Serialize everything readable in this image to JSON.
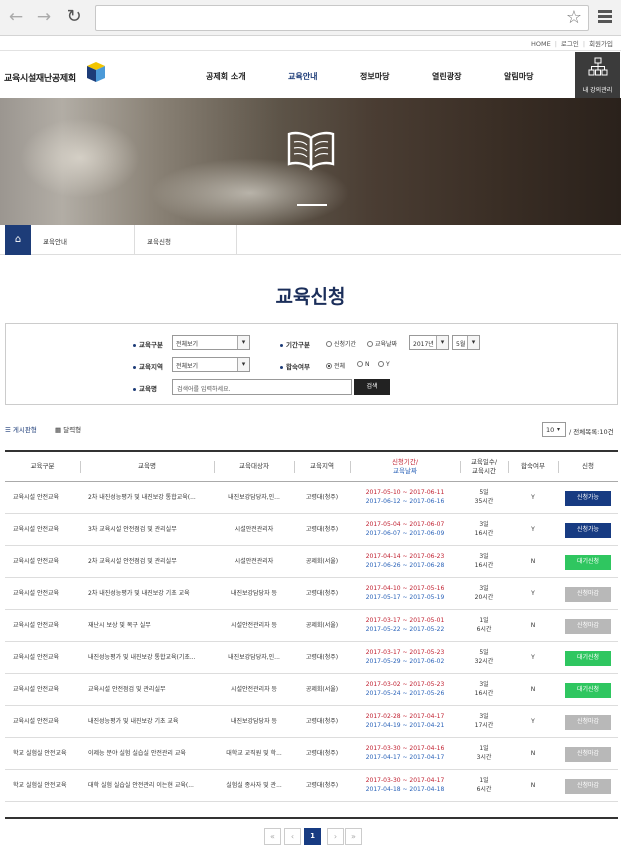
{
  "browser": {
    "url": ""
  },
  "util_links": [
    "HOME",
    "로그인",
    "회원가입"
  ],
  "site": {
    "name": "교육시설재난공제회"
  },
  "gnb": [
    "공제회 소개",
    "교육안내",
    "정보마당",
    "열린광장",
    "알림마당"
  ],
  "my_lecture": "내 강의관리",
  "breadcrumb": {
    "level1": "교육안내",
    "level2": "교육신청"
  },
  "page_title": "교육신청",
  "filters": {
    "edu_type_label": "교육구분",
    "edu_type_value": "전체보기",
    "region_label": "교육지역",
    "region_value": "전체보기",
    "keyword_label": "교육명",
    "keyword_placeholder": "검색어를 입력하세요.",
    "search_button": "검색",
    "period_label": "기간구분",
    "period_opt1": "신청기간",
    "period_opt2": "교육날짜",
    "year_value": "2017년",
    "month_value": "5월",
    "accom_label": "합숙여부",
    "accom_opt1": "전체",
    "accom_opt2": "N",
    "accom_opt3": "Y"
  },
  "views": {
    "list": "게시판형",
    "calendar": "달력형"
  },
  "page_size": "10",
  "total": "/ 전체목록:10건",
  "table": {
    "headers": {
      "type": "교육구분",
      "name": "교육명",
      "target": "교육대상자",
      "region": "교육지역",
      "period_top": "신청기간/",
      "period_bottom": "교육날짜",
      "days_top": "교육일수/",
      "days_bottom": "교육시간",
      "accom": "합숙여부",
      "apply": "신청"
    },
    "rows": [
      {
        "type": "교육시설 안전교육",
        "name": "2차 내진성능평가 및 내진보강 통합교육(...",
        "target": "내진보강담당자,인...",
        "region": "고령대(청주)",
        "apply_period": "2017-05-10 ~ 2017-06-11",
        "edu_period": "2017-06-12 ~ 2017-06-16",
        "days": "5일",
        "hours": "35시간",
        "accom": "Y",
        "status": "신청가능",
        "style": "navy"
      },
      {
        "type": "교육시설 안전교육",
        "name": "3차 교육시설 안전점검 및 관리실무",
        "target": "시설안전관리자",
        "region": "고령대(청주)",
        "apply_period": "2017-05-04 ~ 2017-06-07",
        "edu_period": "2017-06-07 ~ 2017-06-09",
        "days": "3일",
        "hours": "16시간",
        "accom": "Y",
        "status": "신청가능",
        "style": "navy"
      },
      {
        "type": "교육시설 안전교육",
        "name": "2차 교육시설 안전점검 및 관리실무",
        "target": "시설안전관리자",
        "region": "공제회(서울)",
        "apply_period": "2017-04-14 ~ 2017-06-23",
        "edu_period": "2017-06-26 ~ 2017-06-28",
        "days": "3일",
        "hours": "16시간",
        "accom": "N",
        "status": "대기신청",
        "style": "green"
      },
      {
        "type": "교육시설 안전교육",
        "name": "2차 내진성능평가 및 내진보강 기초 교육",
        "target": "내진보강담당자 등",
        "region": "고령대(청주)",
        "apply_period": "2017-04-10 ~ 2017-05-16",
        "edu_period": "2017-05-17 ~ 2017-05-19",
        "days": "3일",
        "hours": "20시간",
        "accom": "Y",
        "status": "신청마감",
        "style": "gray"
      },
      {
        "type": "교육시설 안전교육",
        "name": "재난시 보상 및 복구 실무",
        "target": "시설안전관리자 등",
        "region": "공제회(서울)",
        "apply_period": "2017-03-17 ~ 2017-05-01",
        "edu_period": "2017-05-22 ~ 2017-05-22",
        "days": "1일",
        "hours": "6시간",
        "accom": "N",
        "status": "신청마감",
        "style": "gray"
      },
      {
        "type": "교육시설 안전교육",
        "name": "내진성능평가 및 내진보강 통합교육(기초...",
        "target": "내진보강담당자,인...",
        "region": "고령대(청주)",
        "apply_period": "2017-03-17 ~ 2017-05-23",
        "edu_period": "2017-05-29 ~ 2017-06-02",
        "days": "5일",
        "hours": "32시간",
        "accom": "Y",
        "status": "대기신청",
        "style": "green"
      },
      {
        "type": "교육시설 안전교육",
        "name": "교육시설 안전점검 및 관리실무",
        "target": "시설안전관리자 등",
        "region": "공제회(서울)",
        "apply_period": "2017-03-02 ~ 2017-05-23",
        "edu_period": "2017-05-24 ~ 2017-05-26",
        "days": "3일",
        "hours": "16시간",
        "accom": "N",
        "status": "대기신청",
        "style": "green"
      },
      {
        "type": "교육시설 안전교육",
        "name": "내진성능평가 및 내진보강 기초 교육",
        "target": "내진보강담당자 등",
        "region": "고령대(청주)",
        "apply_period": "2017-02-28 ~ 2017-04-17",
        "edu_period": "2017-04-19 ~ 2017-04-21",
        "days": "3일",
        "hours": "17시간",
        "accom": "Y",
        "status": "신청마감",
        "style": "gray"
      },
      {
        "type": "학교 실험실 안전교육",
        "name": "이제능 분야 실험 실습실 안전관리 교육",
        "target": "대학교 교직원 및 학...",
        "region": "고령대(청주)",
        "apply_period": "2017-03-30 ~ 2017-04-16",
        "edu_period": "2017-04-17 ~ 2017-04-17",
        "days": "1일",
        "hours": "3시간",
        "accom": "N",
        "status": "신청마감",
        "style": "gray"
      },
      {
        "type": "학교 실험실 안전교육",
        "name": "대학 실험 실습실 안전관리 이는현 교육(...",
        "target": "실험실 종사자 및 관...",
        "region": "고령대(청주)",
        "apply_period": "2017-03-30 ~ 2017-04-17",
        "edu_period": "2017-04-18 ~ 2017-04-18",
        "days": "1일",
        "hours": "6시간",
        "accom": "N",
        "status": "신청마감",
        "style": "gray"
      }
    ]
  },
  "pagination": {
    "first": "«",
    "prev": "‹",
    "current": "1",
    "next": "›",
    "last": "»"
  },
  "colors": {
    "navy": "#173b82",
    "green": "#2fc660",
    "gray": "#b8b8b8",
    "red": "#c01f2f",
    "blue": "#2a62b8"
  }
}
